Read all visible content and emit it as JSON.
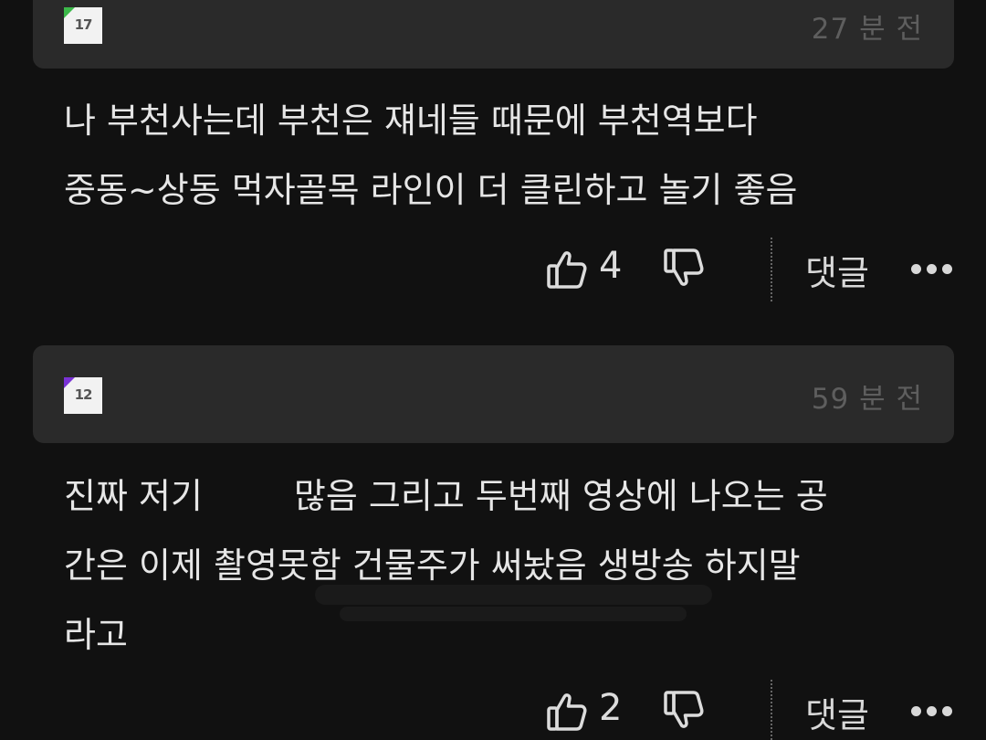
{
  "comments": [
    {
      "badge_number": "17",
      "badge_color": "#3cb94a",
      "timestamp": "27 분 전",
      "lines": [
        "나 부천사는데 부천은 쟤네들 때문에 부천역보다",
        "중동~상동 먹자골목 라인이 더 클린하고 놀기 좋음"
      ],
      "likes": "4",
      "reply_label": "댓글"
    },
    {
      "badge_number": "12",
      "badge_color": "#7a32d6",
      "timestamp": "59 분 전",
      "lines": [
        "진짜 저기",
        "많음 그리고 두번째 영상에 나오는 공",
        "간은 이제 촬영못함 건물주가 써놨음 생방송 하지말",
        "라고"
      ],
      "likes": "2",
      "reply_label": "댓글"
    }
  ],
  "icons": {
    "like": "thumbs-up-icon",
    "dislike": "thumbs-down-icon",
    "more": "more-options-icon"
  }
}
